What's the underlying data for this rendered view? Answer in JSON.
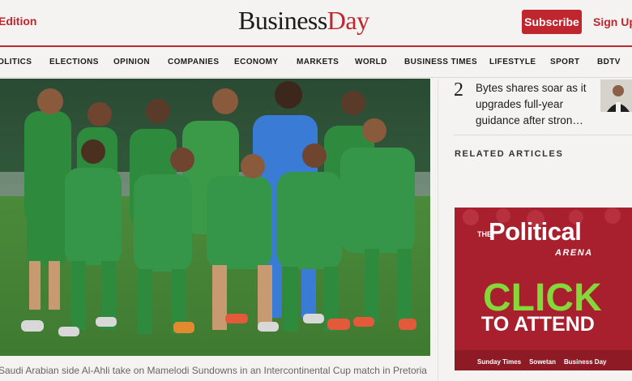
{
  "header": {
    "edition_label": "Edition",
    "logo_part1": "Business",
    "logo_part2": "Day",
    "subscribe_label": "Subscribe",
    "signup_label": "Sign Up"
  },
  "nav": {
    "items": [
      "POLITICS",
      "ELECTIONS",
      "OPINION",
      "COMPANIES",
      "ECONOMY",
      "MARKETS",
      "WORLD",
      "BUSINESS TIMES",
      "LIFESTYLE",
      "SPORT",
      "BDTV"
    ]
  },
  "hero": {
    "caption": "Saudi Arabian side Al-Ahli take on Mamelodi Sundowns in an Intercontinental Cup match in Pretoria on"
  },
  "sidebar": {
    "trending_number": "2",
    "trending_title": "Bytes shares soar as it upgrades full-year guidance after stron…",
    "related_heading": "RELATED ARTICLES"
  },
  "ad": {
    "the": "THE",
    "political": "Political",
    "arena": "ARENA",
    "click": "CLICK",
    "attend": "TO ATTEND",
    "logos": [
      "Sunday Times",
      "Sowetan",
      "Business Day"
    ]
  },
  "colors": {
    "brand_red": "#c0262d",
    "kit_green": "#2e8b3e",
    "keeper_blue": "#3a7bd5",
    "ad_bg": "#a8202e",
    "ad_green": "#86d83a"
  }
}
